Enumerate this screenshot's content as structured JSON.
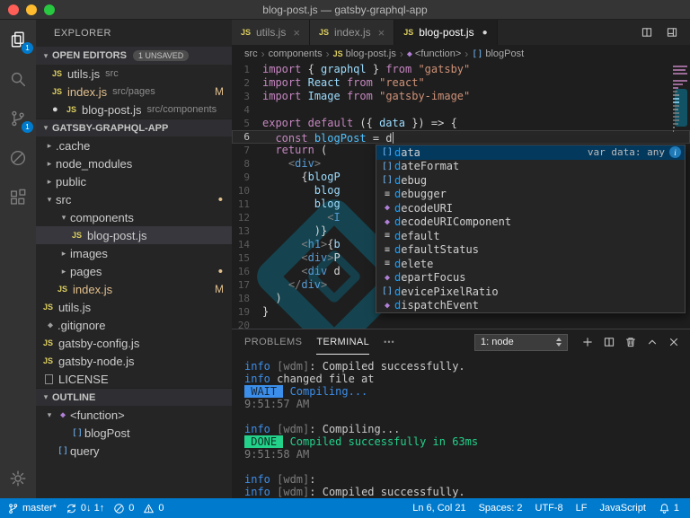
{
  "title_bar": {
    "title": "blog-post.js — gatsby-graphql-app"
  },
  "activity_bar": {
    "items": [
      {
        "name": "explorer",
        "icon": "explorer",
        "active": true,
        "badge": "1"
      },
      {
        "name": "search",
        "icon": "search"
      },
      {
        "name": "source-control",
        "icon": "scm",
        "badge": "1"
      },
      {
        "name": "debug",
        "icon": "debug"
      },
      {
        "name": "extensions",
        "icon": "extensions"
      }
    ],
    "bottom": [
      {
        "name": "settings",
        "icon": "gear"
      }
    ]
  },
  "sidebar": {
    "title": "EXPLORER",
    "open_editors": {
      "header": "OPEN EDITORS",
      "badge": "1 UNSAVED",
      "items": [
        {
          "label": "utils.js",
          "desc": "src"
        },
        {
          "label": "index.js",
          "desc": "src/pages",
          "git": "M"
        },
        {
          "label": "blog-post.js",
          "desc": "src/components",
          "dirty": true
        }
      ]
    },
    "workspace": {
      "header": "GATSBY-GRAPHQL-APP",
      "items": [
        {
          "type": "folder",
          "label": ".cache",
          "indent": 0
        },
        {
          "type": "folder",
          "label": "node_modules",
          "indent": 0
        },
        {
          "type": "folder",
          "label": "public",
          "indent": 0
        },
        {
          "type": "folder",
          "label": "src",
          "indent": 0,
          "expanded": true,
          "dot": true
        },
        {
          "type": "folder",
          "label": "components",
          "indent": 1,
          "expanded": true
        },
        {
          "type": "file",
          "label": "blog-post.js",
          "indent": 2,
          "selected": true
        },
        {
          "type": "folder",
          "label": "images",
          "indent": 1
        },
        {
          "type": "folder",
          "label": "pages",
          "indent": 1,
          "dot": true
        },
        {
          "type": "file",
          "label": "index.js",
          "indent": 1,
          "git": "M"
        },
        {
          "type": "file",
          "label": "utils.js",
          "indent": 0
        },
        {
          "type": "file",
          "label": ".gitignore",
          "indent": 0,
          "icon": "diamond"
        },
        {
          "type": "file",
          "label": "gatsby-config.js",
          "indent": 0
        },
        {
          "type": "file",
          "label": "gatsby-node.js",
          "indent": 0
        },
        {
          "type": "file",
          "label": "LICENSE",
          "indent": 0,
          "icon": "file"
        }
      ]
    },
    "outline": {
      "header": "OUTLINE",
      "items": [
        {
          "icon": "fn",
          "label": "<function>",
          "indent": 0,
          "expanded": true
        },
        {
          "icon": "var",
          "label": "blogPost",
          "indent": 1
        },
        {
          "icon": "var",
          "label": "query",
          "indent": 0
        }
      ]
    }
  },
  "editor": {
    "tabs": [
      {
        "label": "utils.js"
      },
      {
        "label": "index.js"
      },
      {
        "label": "blog-post.js",
        "active": true,
        "dirty": true
      }
    ],
    "actions": [
      {
        "name": "split-editor"
      },
      {
        "name": "editor-layout"
      }
    ],
    "breadcrumbs": [
      {
        "label": "src"
      },
      {
        "label": "components"
      },
      {
        "label": "blog-post.js",
        "icon": "js"
      },
      {
        "label": "<function>",
        "icon": "fn"
      },
      {
        "label": "blogPost",
        "icon": "var"
      }
    ],
    "cursor_line": 6,
    "lines": [
      [
        {
          "c": "kw",
          "t": "import"
        },
        {
          "c": "pn",
          "t": " { "
        },
        {
          "c": "id",
          "t": "graphql"
        },
        {
          "c": "pn",
          "t": " } "
        },
        {
          "c": "kw",
          "t": "from"
        },
        {
          "c": "pn",
          "t": " "
        },
        {
          "c": "str",
          "t": "\"gatsby\""
        }
      ],
      [
        {
          "c": "kw",
          "t": "import"
        },
        {
          "c": "pn",
          "t": " "
        },
        {
          "c": "id",
          "t": "React"
        },
        {
          "c": "pn",
          "t": " "
        },
        {
          "c": "kw",
          "t": "from"
        },
        {
          "c": "pn",
          "t": " "
        },
        {
          "c": "str",
          "t": "\"react\""
        }
      ],
      [
        {
          "c": "kw",
          "t": "import"
        },
        {
          "c": "pn",
          "t": " "
        },
        {
          "c": "id",
          "t": "Image"
        },
        {
          "c": "pn",
          "t": " "
        },
        {
          "c": "kw",
          "t": "from"
        },
        {
          "c": "pn",
          "t": " "
        },
        {
          "c": "str",
          "t": "\"gatsby-image\""
        }
      ],
      [],
      [
        {
          "c": "kw",
          "t": "export"
        },
        {
          "c": "pn",
          "t": " "
        },
        {
          "c": "kw",
          "t": "default"
        },
        {
          "c": "pn",
          "t": " ({ "
        },
        {
          "c": "id",
          "t": "data"
        },
        {
          "c": "pn",
          "t": " }) "
        },
        {
          "c": "pn",
          "t": "=> {"
        }
      ],
      [
        {
          "c": "pn",
          "t": "  "
        },
        {
          "c": "kw",
          "t": "const"
        },
        {
          "c": "pn",
          "t": " "
        },
        {
          "c": "vr",
          "t": "blogPost"
        },
        {
          "c": "pn",
          "t": " = "
        },
        {
          "c": "pn",
          "t": "d"
        }
      ],
      [
        {
          "c": "pn",
          "t": "  "
        },
        {
          "c": "kw",
          "t": "return"
        },
        {
          "c": "pn",
          "t": " ("
        }
      ],
      [
        {
          "c": "pn",
          "t": "    "
        },
        {
          "c": "br",
          "t": "<"
        },
        {
          "c": "tg",
          "t": "div"
        },
        {
          "c": "br",
          "t": ">"
        }
      ],
      [
        {
          "c": "pn",
          "t": "      {"
        },
        {
          "c": "id",
          "t": "blogP"
        }
      ],
      [
        {
          "c": "pn",
          "t": "        "
        },
        {
          "c": "id",
          "t": "blog"
        }
      ],
      [
        {
          "c": "pn",
          "t": "        "
        },
        {
          "c": "id",
          "t": "blog"
        }
      ],
      [
        {
          "c": "pn",
          "t": "          "
        },
        {
          "c": "br",
          "t": "<"
        },
        {
          "c": "tg",
          "t": "I"
        }
      ],
      [
        {
          "c": "pn",
          "t": "        )}"
        }
      ],
      [
        {
          "c": "pn",
          "t": "      "
        },
        {
          "c": "br",
          "t": "<"
        },
        {
          "c": "tg",
          "t": "h1"
        },
        {
          "c": "br",
          "t": ">"
        },
        {
          "c": "pn",
          "t": "{"
        },
        {
          "c": "id",
          "t": "b"
        }
      ],
      [
        {
          "c": "pn",
          "t": "      "
        },
        {
          "c": "br",
          "t": "<"
        },
        {
          "c": "tg",
          "t": "div"
        },
        {
          "c": "br",
          "t": ">"
        },
        {
          "c": "pn",
          "t": "P"
        }
      ],
      [
        {
          "c": "pn",
          "t": "      "
        },
        {
          "c": "br",
          "t": "<"
        },
        {
          "c": "tg",
          "t": "div"
        },
        {
          "c": "pn",
          "t": " d"
        }
      ],
      [
        {
          "c": "pn",
          "t": "    "
        },
        {
          "c": "br",
          "t": "</"
        },
        {
          "c": "tg",
          "t": "div"
        },
        {
          "c": "br",
          "t": ">"
        }
      ],
      [
        {
          "c": "pn",
          "t": "  )"
        }
      ],
      [
        {
          "c": "pn",
          "t": "}"
        }
      ],
      []
    ]
  },
  "suggest": {
    "items": [
      {
        "icon": "var",
        "label": "data",
        "selected": true,
        "detail": "var data: any",
        "info": true
      },
      {
        "icon": "var",
        "label": "dateFormat"
      },
      {
        "icon": "var",
        "label": "debug"
      },
      {
        "icon": "kw",
        "label": "debugger"
      },
      {
        "icon": "fn",
        "label": "decodeURI"
      },
      {
        "icon": "fn",
        "label": "decodeURIComponent"
      },
      {
        "icon": "kw",
        "label": "default"
      },
      {
        "icon": "kw",
        "label": "defaultStatus"
      },
      {
        "icon": "kw",
        "label": "delete"
      },
      {
        "icon": "fn",
        "label": "departFocus"
      },
      {
        "icon": "var",
        "label": "devicePixelRatio"
      },
      {
        "icon": "fn",
        "label": "dispatchEvent"
      }
    ]
  },
  "panel": {
    "tabs": [
      {
        "label": "PROBLEMS"
      },
      {
        "label": "TERMINAL",
        "active": true
      }
    ],
    "overflow_label": "•••",
    "terminal_select": "1: node",
    "actions": [
      {
        "name": "new-terminal",
        "icon": "plus"
      },
      {
        "name": "split-terminal",
        "icon": "split"
      },
      {
        "name": "kill-terminal",
        "icon": "trash"
      },
      {
        "name": "maximize-panel",
        "icon": "chevup"
      },
      {
        "name": "close-panel",
        "icon": "close"
      }
    ]
  },
  "terminal": {
    "lines": [
      [
        {
          "c": "info",
          "t": "info"
        },
        {
          "c": "dim",
          "t": " [wdm]"
        },
        {
          "c": "fg",
          "t": ": Compiled successfully."
        }
      ],
      [
        {
          "c": "info",
          "t": "info"
        },
        {
          "c": "fg",
          "t": " changed file at"
        }
      ],
      [
        {
          "c": "wait",
          "t": " WAIT "
        },
        {
          "c": "blue",
          "t": " Compiling..."
        }
      ],
      [
        {
          "c": "dim",
          "t": "9:51:57 AM"
        }
      ],
      [],
      [
        {
          "c": "info",
          "t": "info"
        },
        {
          "c": "dim",
          "t": " [wdm]"
        },
        {
          "c": "fg",
          "t": ": Compiling..."
        }
      ],
      [
        {
          "c": "done",
          "t": " DONE "
        },
        {
          "c": "green",
          "t": " Compiled successfully in 63ms"
        }
      ],
      [
        {
          "c": "dim",
          "t": "9:51:58 AM"
        }
      ],
      [],
      [
        {
          "c": "info",
          "t": "info"
        },
        {
          "c": "dim",
          "t": " [wdm]"
        },
        {
          "c": "fg",
          "t": ":"
        }
      ],
      [
        {
          "c": "info",
          "t": "info"
        },
        {
          "c": "dim",
          "t": " [wdm]"
        },
        {
          "c": "fg",
          "t": ": Compiled successfully."
        }
      ]
    ]
  },
  "status_bar": {
    "left": [
      {
        "name": "branch",
        "icon": "branch",
        "label": "master*"
      },
      {
        "name": "sync",
        "icon": "sync",
        "label": "0↓ 1↑"
      },
      {
        "name": "errors",
        "icon": "error",
        "label": "0"
      },
      {
        "name": "warnings",
        "icon": "warning",
        "label": "0"
      }
    ],
    "right": [
      {
        "name": "cursor-position",
        "label": "Ln 6, Col 21"
      },
      {
        "name": "indentation",
        "label": "Spaces: 2"
      },
      {
        "name": "encoding",
        "label": "UTF-8"
      },
      {
        "name": "eol",
        "label": "LF"
      },
      {
        "name": "language",
        "label": "JavaScript"
      },
      {
        "name": "notifications",
        "icon": "bell",
        "label": "1"
      }
    ]
  },
  "colors": {
    "accent": "#007acc",
    "git_modified": "#e2c08d",
    "success": "#23d18b",
    "info_blue": "#3b8eea"
  }
}
